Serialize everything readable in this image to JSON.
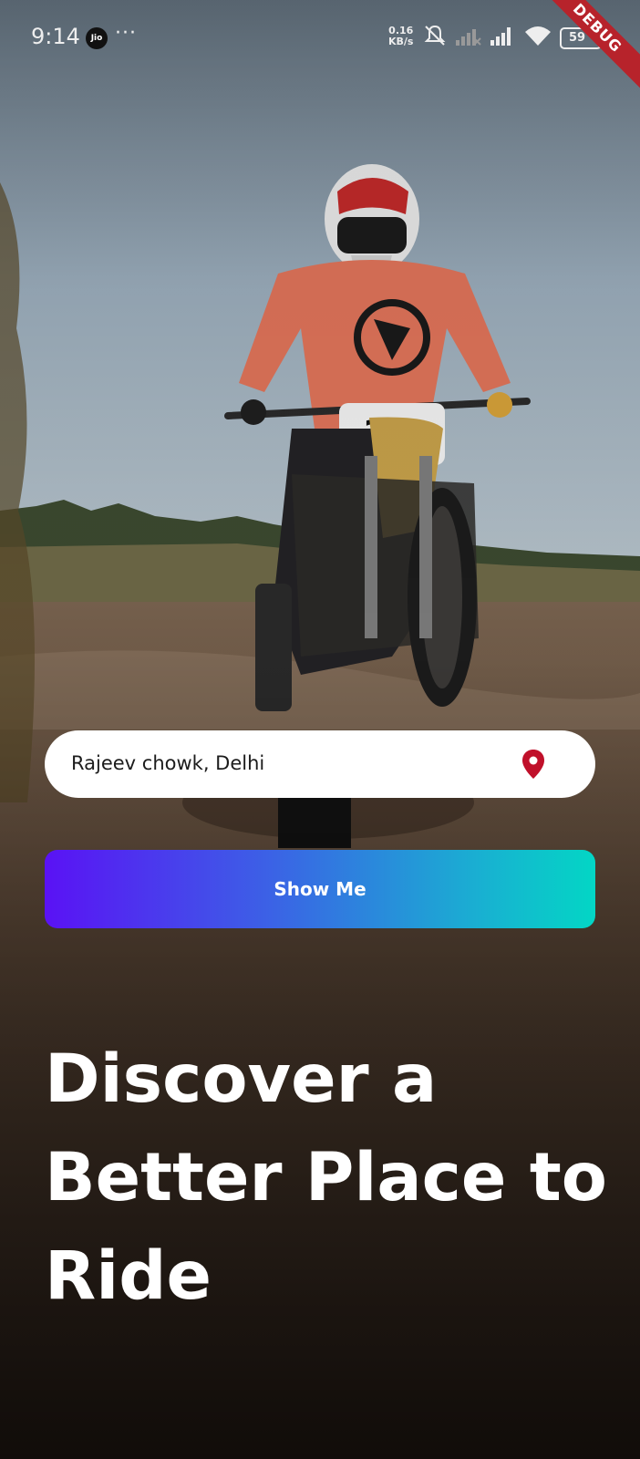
{
  "status_bar": {
    "time": "9:14",
    "carrier_icon": "jio-icon",
    "carrier_text": "Jio",
    "more": "···",
    "speed_value": "0.16",
    "speed_unit": "KB/s",
    "battery": "59",
    "icons": [
      "mute-icon",
      "signal-icon",
      "signal-icon",
      "wifi-icon",
      "battery-icon"
    ]
  },
  "debug_banner": "DEBUG",
  "location": {
    "value": "Rajeev chowk, Delhi",
    "icon": "location-pin-icon",
    "pin_color": "#c0102a"
  },
  "cta": {
    "label": "Show Me",
    "gradient_start": "#5a12f5",
    "gradient_end": "#03d6c5"
  },
  "headline": "Discover a Better Place to Ride"
}
